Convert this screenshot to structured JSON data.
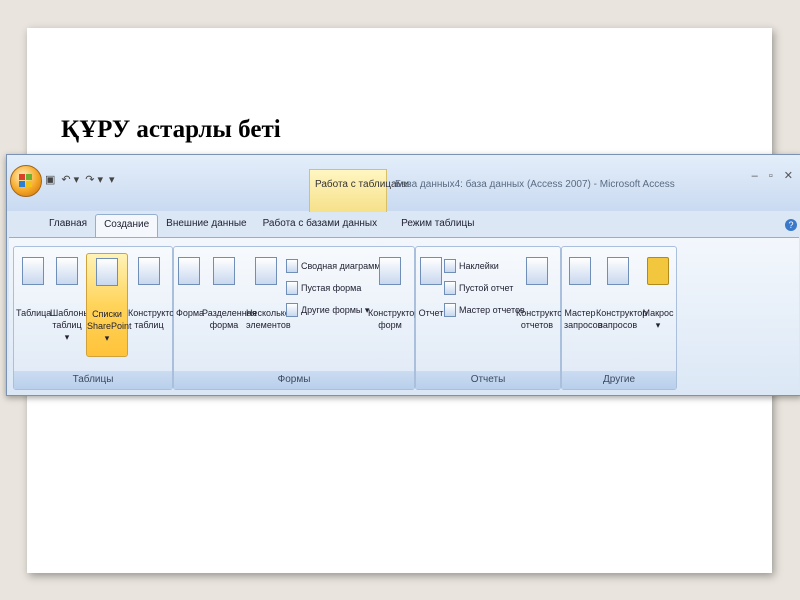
{
  "slide": {
    "title": "ҚҰРУ астарлы беті"
  },
  "window": {
    "contextual_tab": "Работа с таблицами",
    "title": "База данных4: база данных (Access 2007) - Microsoft Access"
  },
  "tabs": [
    {
      "label": "Главная",
      "active": false
    },
    {
      "label": "Создание",
      "active": true
    },
    {
      "label": "Внешние данные",
      "active": false
    },
    {
      "label": "Работа с базами данных",
      "active": false
    },
    {
      "label": "Режим таблицы",
      "active": false
    }
  ],
  "groups": {
    "tables": {
      "label": "Таблицы",
      "buttons": [
        {
          "label": "Таблица"
        },
        {
          "label": "Шаблоны\nтаблиц ▾"
        },
        {
          "label": "Списки\nSharePoint ▾"
        },
        {
          "label": "Конструктор\nтаблиц"
        }
      ]
    },
    "forms": {
      "label": "Формы",
      "buttons": [
        {
          "label": "Форма"
        },
        {
          "label": "Разделенная\nформа"
        },
        {
          "label": "Несколько\nэлементов"
        },
        {
          "label": "Конструктор\nформ"
        }
      ],
      "small_buttons": [
        {
          "label": "Сводная диаграмма"
        },
        {
          "label": "Пустая форма"
        },
        {
          "label": "Другие формы ▾"
        }
      ]
    },
    "reports": {
      "label": "Отчеты",
      "buttons": [
        {
          "label": "Отчет"
        },
        {
          "label": "Конструктор\nотчетов"
        }
      ],
      "small_buttons": [
        {
          "label": "Наклейки"
        },
        {
          "label": "Пустой отчет"
        },
        {
          "label": "Мастер отчетов"
        }
      ]
    },
    "other": {
      "label": "Другие",
      "buttons": [
        {
          "label": "Мастер\nзапросов"
        },
        {
          "label": "Конструктор\nзапросов"
        },
        {
          "label": "Макрос\n▾"
        }
      ]
    }
  },
  "icons": {
    "office_button": "office-logo-icon",
    "save": "save-icon",
    "undo": "undo-icon",
    "redo": "redo-icon"
  }
}
